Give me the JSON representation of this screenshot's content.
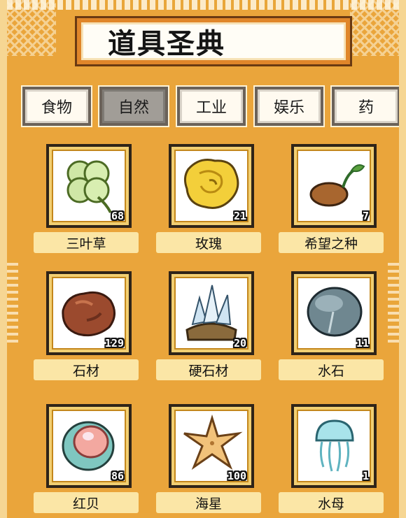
{
  "header": {
    "title": "道具圣典"
  },
  "tabs": [
    {
      "label": "食物",
      "active": false
    },
    {
      "label": "自然",
      "active": true
    },
    {
      "label": "工业",
      "active": false
    },
    {
      "label": "娱乐",
      "active": false
    },
    {
      "label": "药",
      "active": false
    }
  ],
  "items": [
    {
      "name": "三叶草",
      "count": "68",
      "icon": "clover-icon"
    },
    {
      "name": "玫瑰",
      "count": "21",
      "icon": "rose-icon"
    },
    {
      "name": "希望之种",
      "count": "7",
      "icon": "seed-icon"
    },
    {
      "name": "石材",
      "count": "129",
      "icon": "stone-icon"
    },
    {
      "name": "硬石材",
      "count": "20",
      "icon": "crystal-stone-icon"
    },
    {
      "name": "水石",
      "count": "11",
      "icon": "water-stone-icon"
    },
    {
      "name": "红贝",
      "count": "86",
      "icon": "red-shell-icon"
    },
    {
      "name": "海星",
      "count": "100",
      "icon": "starfish-icon"
    },
    {
      "name": "水母",
      "count": "1",
      "icon": "jellyfish-icon"
    }
  ],
  "colors": {
    "background": "#eaa53b",
    "title_border": "#e0862a",
    "label_bg": "#fbe6a6",
    "active_tab": "#a19d97"
  }
}
